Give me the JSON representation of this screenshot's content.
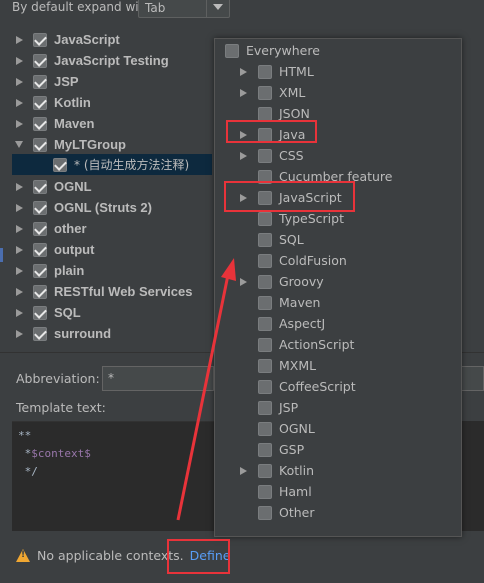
{
  "expand": {
    "label": "By default expand with",
    "value": "Tab"
  },
  "groups": [
    {
      "label": "JavaScript",
      "checked": true,
      "expanded": false
    },
    {
      "label": "JavaScript Testing",
      "checked": true,
      "expanded": false
    },
    {
      "label": "JSP",
      "checked": true,
      "expanded": false
    },
    {
      "label": "Kotlin",
      "checked": true,
      "expanded": false
    },
    {
      "label": "Maven",
      "checked": true,
      "expanded": false
    },
    {
      "label": "MyLTGroup",
      "checked": true,
      "expanded": true
    },
    {
      "label": "OGNL",
      "checked": true,
      "expanded": false
    },
    {
      "label": "OGNL (Struts 2)",
      "checked": true,
      "expanded": false
    },
    {
      "label": "other",
      "checked": true,
      "expanded": false
    },
    {
      "label": "output",
      "checked": true,
      "expanded": false
    },
    {
      "label": "plain",
      "checked": true,
      "expanded": false
    },
    {
      "label": "RESTful Web Services",
      "checked": true,
      "expanded": false
    },
    {
      "label": "SQL",
      "checked": true,
      "expanded": false
    },
    {
      "label": "surround",
      "checked": true,
      "expanded": false
    }
  ],
  "selected_template": {
    "label": "* (自动生成方法注释)",
    "checked": true
  },
  "abbreviation": {
    "label": "Abbreviation:",
    "value": "*"
  },
  "template_text": {
    "label": "Template text:",
    "lines": [
      "**",
      " *",
      " */"
    ],
    "variable": "$context$"
  },
  "warning": {
    "text": "No applicable contexts.",
    "link": "Define"
  },
  "contexts": {
    "root": "Everywhere",
    "items": [
      {
        "label": "HTML",
        "expandable": true
      },
      {
        "label": "XML",
        "expandable": true
      },
      {
        "label": "JSON",
        "expandable": false
      },
      {
        "label": "Java",
        "expandable": true
      },
      {
        "label": "CSS",
        "expandable": true
      },
      {
        "label": "Cucumber feature",
        "expandable": false
      },
      {
        "label": "JavaScript",
        "expandable": true
      },
      {
        "label": "TypeScript",
        "expandable": false
      },
      {
        "label": "SQL",
        "expandable": false
      },
      {
        "label": "ColdFusion",
        "expandable": false
      },
      {
        "label": "Groovy",
        "expandable": true
      },
      {
        "label": "Maven",
        "expandable": false
      },
      {
        "label": "AspectJ",
        "expandable": false
      },
      {
        "label": "ActionScript",
        "expandable": false
      },
      {
        "label": "MXML",
        "expandable": false
      },
      {
        "label": "CoffeeScript",
        "expandable": false
      },
      {
        "label": "JSP",
        "expandable": false
      },
      {
        "label": "OGNL",
        "expandable": false
      },
      {
        "label": "GSP",
        "expandable": false
      },
      {
        "label": "Kotlin",
        "expandable": true
      },
      {
        "label": "Haml",
        "expandable": false
      },
      {
        "label": "Other",
        "expandable": false
      }
    ]
  },
  "colors": {
    "background": "#3c3f41",
    "selection": "#0d293e",
    "link": "#589df6",
    "annotation": "#e8333a",
    "warning": "#f0a732"
  }
}
